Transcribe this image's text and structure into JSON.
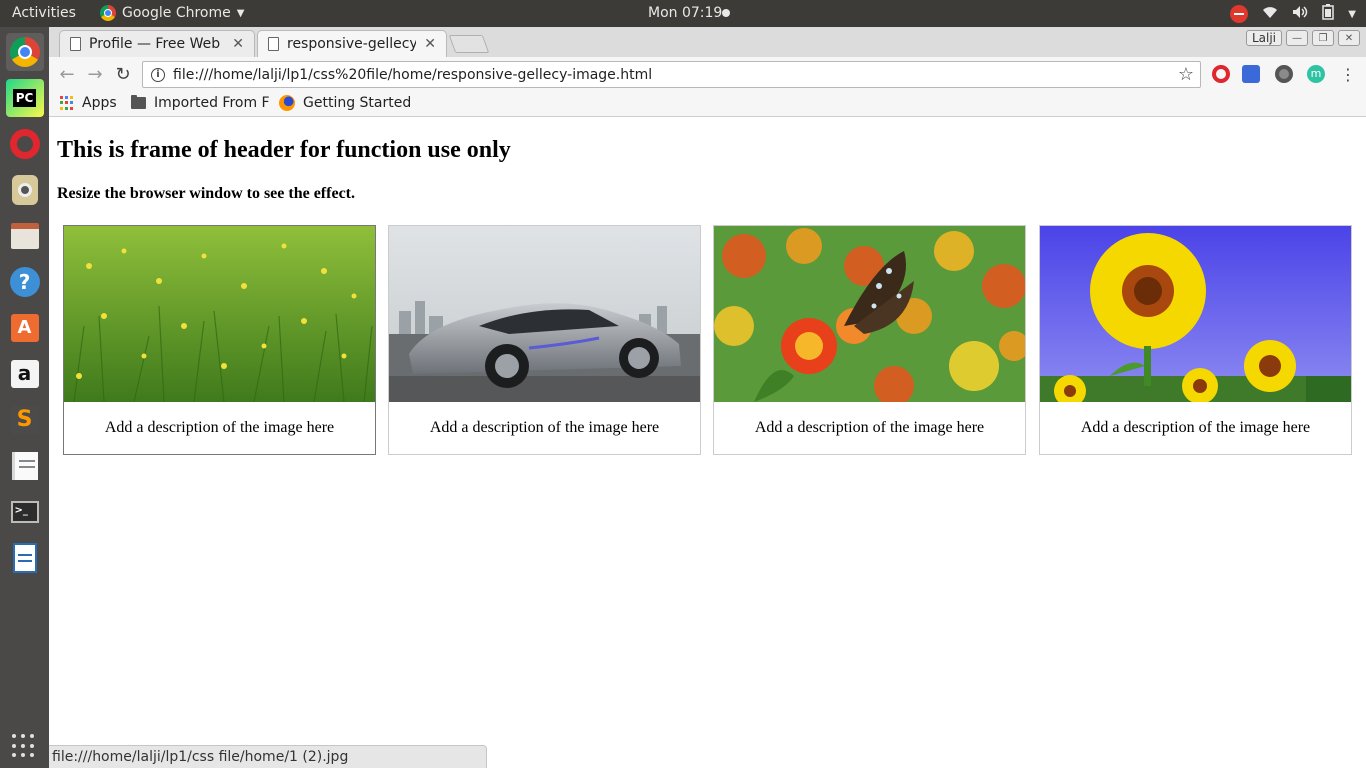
{
  "system": {
    "activities_label": "Activities",
    "app_menu_label": "Google Chrome",
    "clock": "Mon 07:19"
  },
  "browser": {
    "tabs": [
      {
        "title": "Profile — Free Web",
        "active": false
      },
      {
        "title": "responsive-gellecy-",
        "active": true
      }
    ],
    "profile_name": "Lalji",
    "address": "file:///home/lalji/lp1/css%20file/home/responsive-gellecy-image.html",
    "bookmarks": [
      {
        "label": "Apps",
        "icon": "apps-grid-icon"
      },
      {
        "label": "Imported From F",
        "icon": "folder-icon"
      },
      {
        "label": "Getting Started",
        "icon": "firefox-icon"
      }
    ],
    "status_url": "file:///home/lalji/lp1/css file/home/1 (2).jpg"
  },
  "page": {
    "heading": "This is frame of header for function use only",
    "subtitle": "Resize the browser window to see the effect.",
    "gallery": [
      {
        "image": "grass-field-with-yellow-flowers",
        "description": "Add a description of the image here"
      },
      {
        "image": "silver-concept-sports-car",
        "description": "Add a description of the image here"
      },
      {
        "image": "butterfly-on-orange-flowers",
        "description": "Add a description of the image here"
      },
      {
        "image": "sunflowers-blue-sky",
        "description": "Add a description of the image here"
      }
    ]
  },
  "dock": {
    "items": [
      "chrome-icon",
      "pycharm-icon",
      "opera-icon",
      "rhythmbox-icon",
      "files-icon",
      "help-icon",
      "software-center-icon",
      "amazon-icon",
      "sublime-text-icon",
      "text-editor-icon",
      "terminal-icon",
      "writer-icon"
    ]
  },
  "colors": {
    "topbar": "#3c3b37",
    "dock": "#4a4948",
    "accent_orange": "#e95420"
  }
}
